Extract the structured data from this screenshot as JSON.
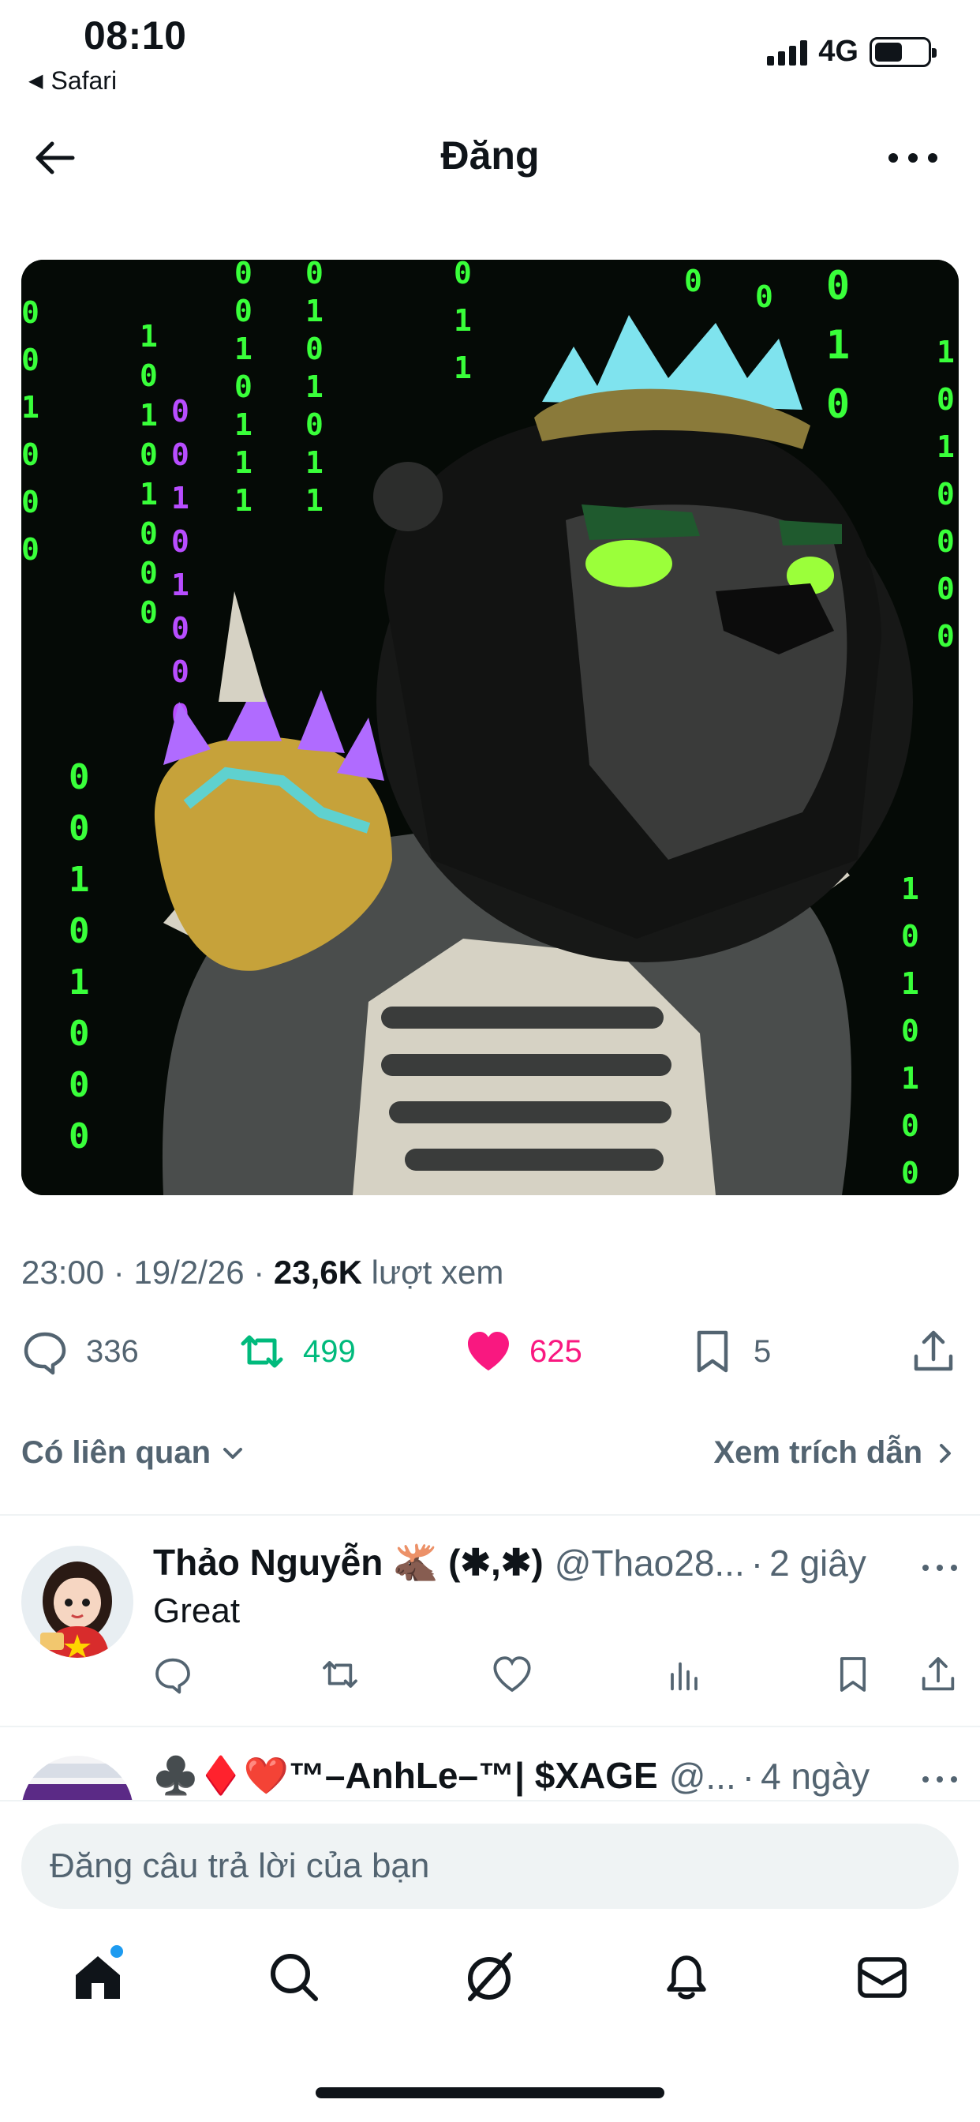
{
  "status_bar": {
    "time": "08:10",
    "back_app": "Safari",
    "network": "4G"
  },
  "header": {
    "title": "Đăng"
  },
  "post": {
    "time": "23:00",
    "date": "19/2/26",
    "views_count": "23,6K",
    "views_label": "lượt xem",
    "stats": {
      "replies": "336",
      "reposts": "499",
      "likes": "625",
      "bookmarks": "5"
    }
  },
  "related": {
    "label": "Có liên quan",
    "quotes_link": "Xem trích dẫn"
  },
  "replies": [
    {
      "name": "Thảo Nguyễn 🫎 (✱,✱)",
      "handle": "@Thao28...",
      "separator": "·",
      "time": "2 giây",
      "text": "Great"
    },
    {
      "name": "♣️♦️❤️™–AnhLe–™| $XAGE",
      "handle": "@...",
      "separator": "·",
      "time": "4 ngày"
    }
  ],
  "composer": {
    "placeholder": "Đăng câu trả lời của bạn"
  },
  "colors": {
    "accent": "#1d9bf0",
    "repost": "#00ba7c",
    "like": "#f91880",
    "secondary_text": "#536471",
    "matrix_green": "#39ff3a",
    "matrix_purple": "#b84dff"
  },
  "icons": [
    "back-arrow-icon",
    "more-icon",
    "reply-icon",
    "repost-icon",
    "heart-filled-icon",
    "bookmark-icon",
    "share-icon",
    "chevron-down-icon",
    "chevron-right-icon",
    "views-icon",
    "home-icon",
    "search-icon",
    "grok-icon",
    "bell-icon",
    "mail-icon"
  ]
}
